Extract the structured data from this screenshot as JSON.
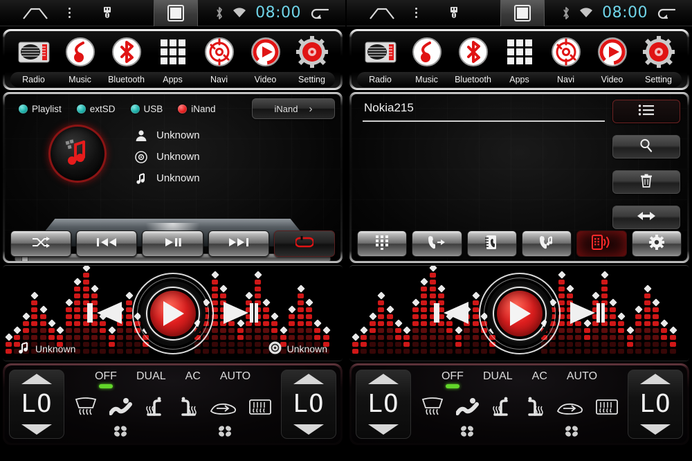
{
  "statusbar": {
    "home_icon": "home-icon",
    "menu_icon": "overflow-menu-icon",
    "usb_icon": "usb-icon",
    "recents_icon": "recents-square-icon",
    "bluetooth_icon": "bluetooth-icon",
    "wifi_icon": "wifi-icon",
    "time": "08:00",
    "back_icon": "back-arrow-icon",
    "time_color": "#6fd4e8"
  },
  "dock": {
    "items": [
      {
        "label": "Radio",
        "icon": "radio-icon"
      },
      {
        "label": "Music",
        "icon": "music-note-icon"
      },
      {
        "label": "Bluetooth",
        "icon": "bluetooth-icon"
      },
      {
        "label": "Apps",
        "icon": "apps-grid-icon"
      },
      {
        "label": "Navi",
        "icon": "navigation-compass-icon"
      },
      {
        "label": "Video",
        "icon": "video-play-icon"
      },
      {
        "label": "Setting",
        "icon": "gear-icon"
      }
    ]
  },
  "media": {
    "sources": [
      {
        "label": "Playlist",
        "selected": false
      },
      {
        "label": "extSD",
        "selected": false
      },
      {
        "label": "USB",
        "selected": false
      },
      {
        "label": "iNand",
        "selected": true
      }
    ],
    "source_select": {
      "value": "iNand",
      "chevron": "chevron-right-icon"
    },
    "album_art_icon": "music-note-icon",
    "track": {
      "artist": "Unknown",
      "album": "Unknown",
      "title": "Unknown",
      "artist_icon": "person-icon",
      "album_icon": "disc-icon",
      "title_icon": "music-note-icon"
    },
    "progress_percent": 2,
    "controls": [
      {
        "name": "shuffle",
        "icon": "shuffle-icon",
        "active": false
      },
      {
        "name": "previous",
        "icon": "previous-track-icon",
        "active": false
      },
      {
        "name": "play-pause",
        "icon": "play-pause-icon",
        "active": false
      },
      {
        "name": "next",
        "icon": "next-track-icon",
        "active": false
      },
      {
        "name": "repeat",
        "icon": "repeat-icon",
        "active": true
      }
    ]
  },
  "phone": {
    "device_name": "Nokia215",
    "side_buttons": [
      {
        "name": "list",
        "icon": "list-icon",
        "selected": true
      },
      {
        "name": "search",
        "icon": "search-icon",
        "selected": false
      },
      {
        "name": "delete",
        "icon": "trash-icon",
        "selected": false
      },
      {
        "name": "transfer",
        "icon": "transfer-icon",
        "selected": false
      }
    ],
    "bottom_buttons": [
      {
        "name": "keypad",
        "icon": "dialpad-icon",
        "active": false
      },
      {
        "name": "outgoing-calls",
        "icon": "call-outgoing-icon",
        "active": false
      },
      {
        "name": "contacts",
        "icon": "contacts-book-icon",
        "active": false
      },
      {
        "name": "call-history",
        "icon": "call-history-icon",
        "active": false
      },
      {
        "name": "bluetooth-phone",
        "icon": "phone-signal-icon",
        "active": true
      },
      {
        "name": "settings",
        "icon": "gear-icon",
        "active": false
      }
    ]
  },
  "visualizer": {
    "prev_icon": "previous-track-icon",
    "next_icon": "next-track-icon",
    "play_icon": "play-icon",
    "left_label": {
      "icon": "music-note-icon",
      "text": "Unknown"
    },
    "right_label": {
      "icon": "disc-icon",
      "text": "Unknown"
    },
    "bar_color": "#cf1717",
    "peak_color": "#e9e9e9"
  },
  "hvac": {
    "left_temp": "LO",
    "right_temp": "LO",
    "modes": [
      {
        "label": "OFF",
        "led": true
      },
      {
        "label": "DUAL",
        "led": false
      },
      {
        "label": "AC",
        "led": false
      },
      {
        "label": "AUTO",
        "led": false
      }
    ],
    "led_color": "#62d62a",
    "icons": [
      "front-defrost-icon",
      "airflow-body-icon",
      "seat-heater-left-icon",
      "seat-heater-right-icon",
      "air-recirculation-icon",
      "rear-defrost-icon"
    ],
    "fan_icons": [
      "fan-left-icon",
      "fan-right-icon"
    ],
    "up_arrow_icon": "arrow-up-icon",
    "down_arrow_icon": "arrow-down-icon"
  }
}
